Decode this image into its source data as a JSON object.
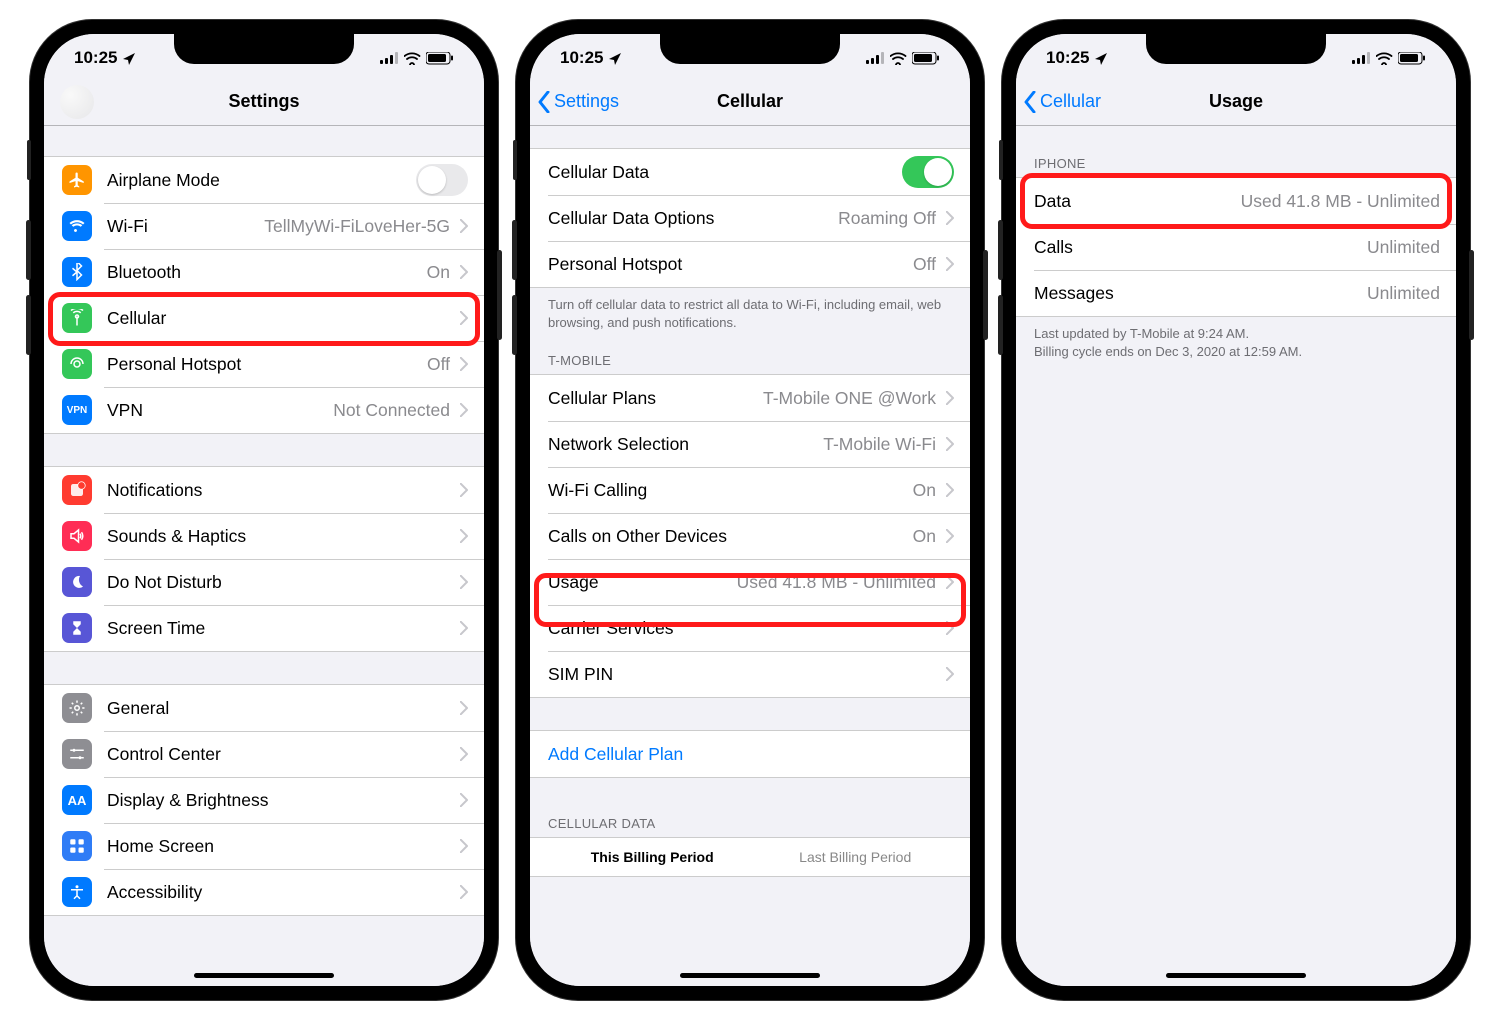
{
  "status": {
    "time": "10:25"
  },
  "screen1": {
    "title": "Settings",
    "group1": {
      "airplane": "Airplane Mode",
      "wifi_label": "Wi-Fi",
      "wifi_value": "TellMyWi-FiLoveHer-5G",
      "bt_label": "Bluetooth",
      "bt_value": "On",
      "cellular": "Cellular",
      "hotspot_label": "Personal Hotspot",
      "hotspot_value": "Off",
      "vpn_label": "VPN",
      "vpn_value": "Not Connected"
    },
    "group2": {
      "notifications": "Notifications",
      "sounds": "Sounds & Haptics",
      "dnd": "Do Not Disturb",
      "screentime": "Screen Time"
    },
    "group3": {
      "general": "General",
      "controlcenter": "Control Center",
      "display": "Display & Brightness",
      "homescreen": "Home Screen",
      "accessibility": "Accessibility"
    }
  },
  "screen2": {
    "back": "Settings",
    "title": "Cellular",
    "group1": {
      "data": "Cellular Data",
      "options_label": "Cellular Data Options",
      "options_value": "Roaming Off",
      "hotspot_label": "Personal Hotspot",
      "hotspot_value": "Off",
      "footer": "Turn off cellular data to restrict all data to Wi-Fi, including email, web browsing, and push notifications."
    },
    "group2": {
      "header": "T-MOBILE",
      "plans_label": "Cellular Plans",
      "plans_value": "T-Mobile ONE @Work",
      "network_label": "Network Selection",
      "network_value": "T-Mobile Wi-Fi",
      "wificall_label": "Wi-Fi Calling",
      "wificall_value": "On",
      "otherdev_label": "Calls on Other Devices",
      "otherdev_value": "On",
      "usage_label": "Usage",
      "usage_value": "Used 41.8 MB - Unlimited",
      "carrier": "Carrier Services",
      "sim": "SIM PIN"
    },
    "group3": {
      "add": "Add Cellular Plan"
    },
    "group4": {
      "header": "CELLULAR DATA",
      "thisperiod": "This Billing Period",
      "lastperiod": "Last Billing Period"
    }
  },
  "screen3": {
    "back": "Cellular",
    "title": "Usage",
    "group1": {
      "header": "IPHONE",
      "data_label": "Data",
      "data_value": "Used 41.8 MB - Unlimited",
      "calls_label": "Calls",
      "calls_value": "Unlimited",
      "msgs_label": "Messages",
      "msgs_value": "Unlimited",
      "footer": "Last updated by T-Mobile at 9:24 AM.\nBilling cycle ends on Dec 3, 2020 at 12:59 AM."
    }
  }
}
